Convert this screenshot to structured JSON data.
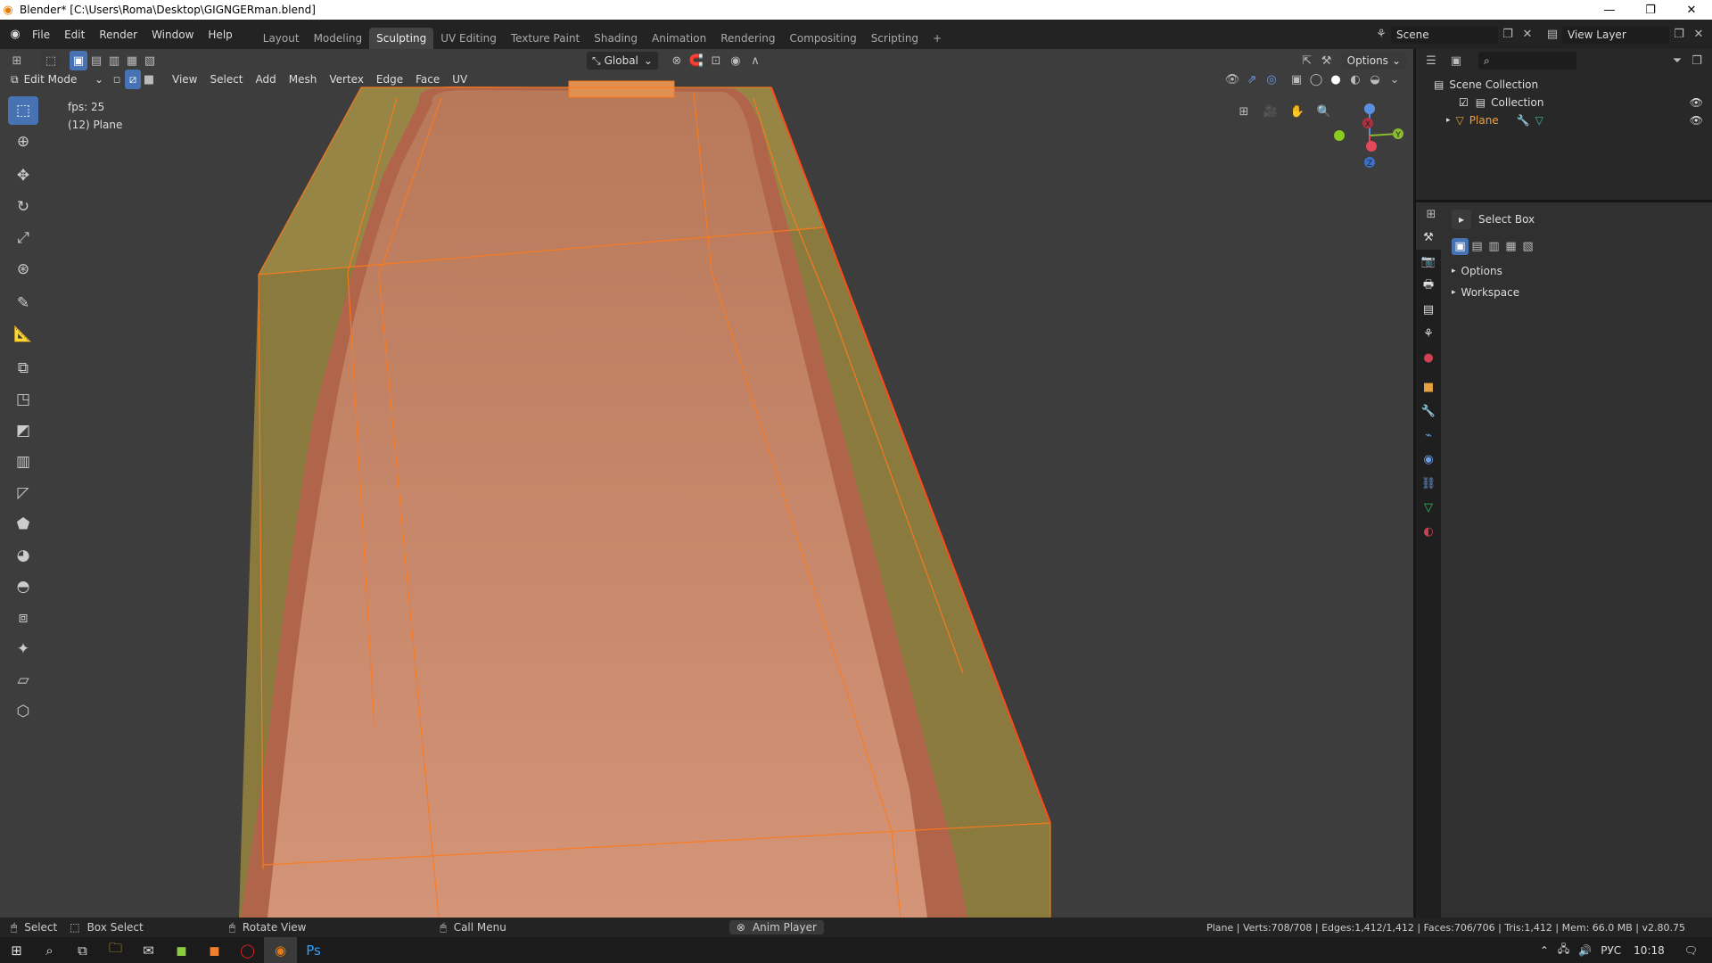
{
  "window": {
    "title": "Blender* [C:\\Users\\Roma\\Desktop\\GIGNGERman.blend]",
    "minimize": "—",
    "restore": "❐",
    "close": "✕"
  },
  "menu": {
    "items": [
      "File",
      "Edit",
      "Render",
      "Window",
      "Help"
    ]
  },
  "workspaces": {
    "tabs": [
      "Layout",
      "Modeling",
      "Sculpting",
      "UV Editing",
      "Texture Paint",
      "Shading",
      "Animation",
      "Rendering",
      "Compositing",
      "Scripting"
    ],
    "active": "Sculpting",
    "add": "+"
  },
  "scene": {
    "name": "Scene",
    "view_layer": "View Layer"
  },
  "viewport": {
    "transform_orientation": "Global",
    "options_label": "Options",
    "mode": "Edit Mode",
    "menus": [
      "View",
      "Select",
      "Add",
      "Mesh",
      "Vertex",
      "Edge",
      "Face",
      "UV"
    ],
    "fps": "fps: 25",
    "object_info": "(12) Plane",
    "gizmo_axes": [
      "X",
      "Y",
      "Z"
    ]
  },
  "outliner": {
    "root": "Scene Collection",
    "collection": "Collection",
    "object": "Plane"
  },
  "properties": {
    "active_tool": "Select Box",
    "panels": [
      "Options",
      "Workspace"
    ]
  },
  "statusbar": {
    "select": "Select",
    "box_select": "Box Select",
    "rotate_view": "Rotate View",
    "call_menu": "Call Menu",
    "anim_player": "Anim Player",
    "stats": "Plane | Verts:708/708 | Edges:1,412/1,412 | Faces:706/706 | Tris:1,412 | Mem: 66.0 MB | v2.80.75"
  },
  "taskbar": {
    "lang": "РУС",
    "time": "10:18"
  },
  "colors": {
    "accent": "#4772b3",
    "mesh_fill": "#c77a55",
    "mesh_edge": "#ff7a1a",
    "outer_shell": "#8a7a3e"
  }
}
